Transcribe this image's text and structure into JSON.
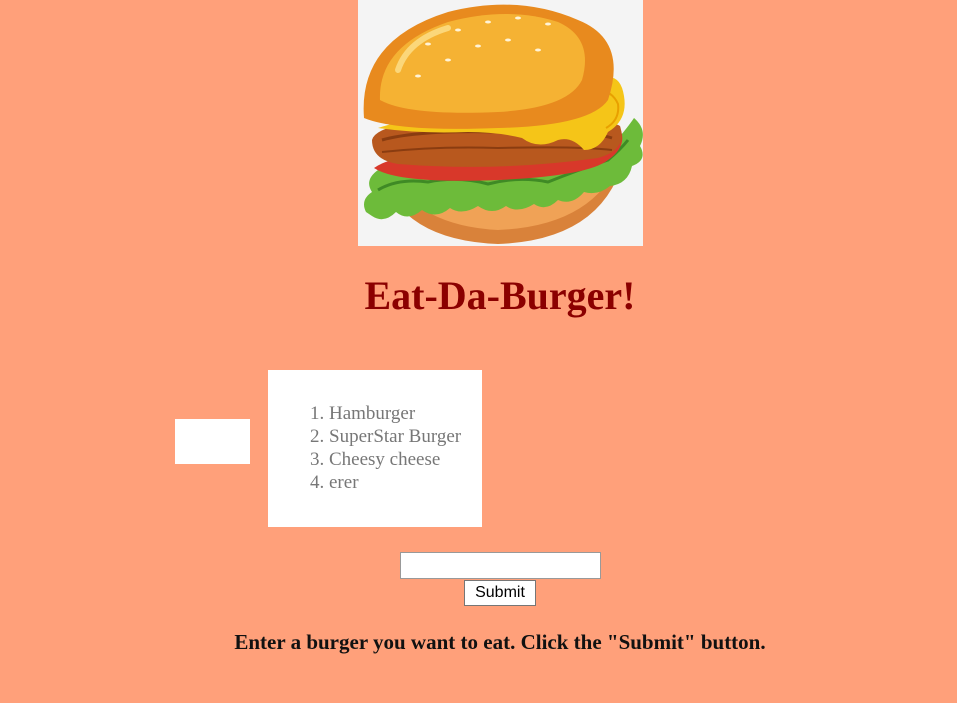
{
  "header": {
    "title": "Eat-Da-Burger!"
  },
  "burgers": {
    "items": [
      {
        "number": "1.",
        "name": "Hamburger"
      },
      {
        "number": "2.",
        "name": "SuperStar Burger"
      },
      {
        "number": "3.",
        "name": "Cheesy cheese"
      },
      {
        "number": "4.",
        "name": "erer"
      }
    ]
  },
  "form": {
    "input_value": "",
    "input_placeholder": "",
    "submit_label": "Submit"
  },
  "instructions": "Enter a burger you want to eat. Click the \"Submit\" button.",
  "icons": {
    "hero": "hamburger-illustration"
  },
  "colors": {
    "background": "#FFA07A",
    "title": "#8B0000",
    "list_text": "#777777"
  }
}
